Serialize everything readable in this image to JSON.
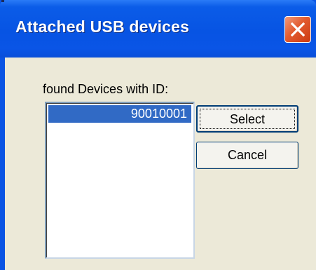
{
  "window": {
    "title": "Attached USB devices"
  },
  "dialog": {
    "label": "found Devices with ID:",
    "devices": [
      "90010001"
    ],
    "selected_index": 0,
    "buttons": {
      "select": "Select",
      "cancel": "Cancel"
    }
  },
  "icons": {
    "close": "close-icon"
  },
  "colors": {
    "titlebar": "#0754e3",
    "dialog_bg": "#ece9d8",
    "selection": "#316ac5",
    "close_button": "#e25b2f"
  }
}
